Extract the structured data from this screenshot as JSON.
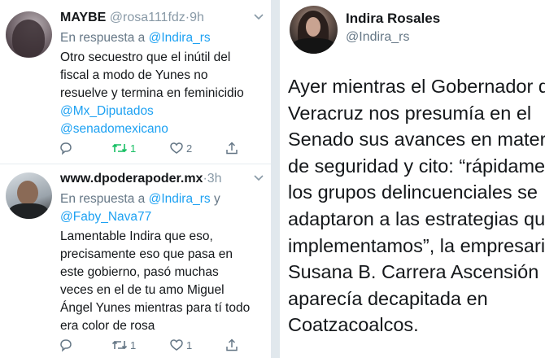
{
  "replies": [
    {
      "name": "MAYBE",
      "handle": "@rosa111fdz",
      "dot": "·",
      "time": "9h",
      "reply_prefix": "En respuesta a",
      "reply_to": "@Indira_rs",
      "body_lines": [
        "Otro secuestro que el inútil del",
        "fiscal a modo de Yunes no",
        "resuelve y termina en feminicidio"
      ],
      "mention_lines": [
        "@Mx_Diputados",
        "@senadomexicano"
      ],
      "actions": {
        "retweets": "1",
        "likes": "2"
      },
      "retweet_active": true
    },
    {
      "name": "www.dpoderapoder.mx",
      "dot": "·",
      "time": "3h",
      "reply_prefix": "En respuesta a",
      "reply_to": "@Indira_rs",
      "reply_joiner": "y",
      "reply_to_2": "@Faby_Nava77",
      "body_lines": [
        "Lamentable Indira que eso,",
        "precisamente eso que pasa en",
        "este gobierno, pasó muchas",
        "veces en el de tu amo Miguel",
        "Ángel Yunes mientras para tí todo",
        "era color de rosa"
      ],
      "actions": {
        "retweets": "1",
        "likes": "1"
      },
      "retweet_active": false
    }
  ],
  "tweet": {
    "name": "Indira Rosales",
    "handle": "@Indira_rs",
    "lines": [
      "Ayer mientras el Gobernador de",
      "Veracruz nos presumía en el",
      "Senado sus avances en materia",
      "de seguridad y cito: “rápidament",
      "los grupos delincuenciales se",
      "adaptaron a las estrategias que",
      "implementamos”, la empresaria",
      "Susana B. Carrera Ascensión",
      "aparecía decapitada en",
      "Coatzacoalcos."
    ]
  },
  "colors": {
    "link": "#1da1f2",
    "muted": "#657786",
    "retweet_active": "#17bf63",
    "divider": "#e1e8ed"
  },
  "icons": [
    "chevron-down-icon",
    "reply-icon",
    "retweet-icon",
    "like-icon",
    "share-icon"
  ]
}
